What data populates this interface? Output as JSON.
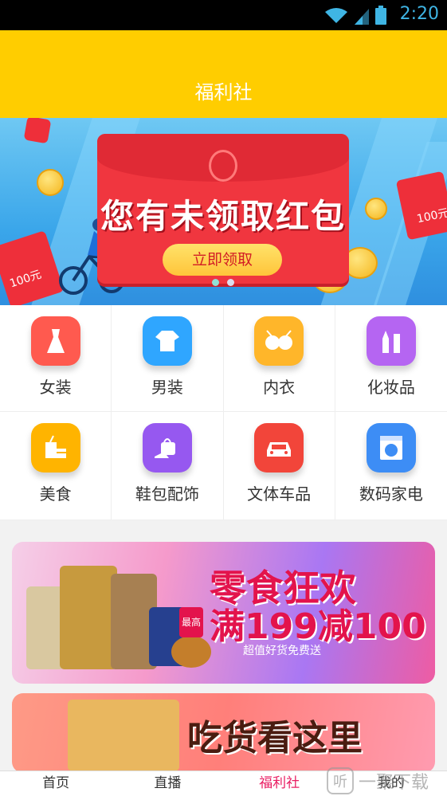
{
  "status_bar": {
    "time": "2:20"
  },
  "header": {
    "title": "福利社"
  },
  "banner": {
    "headline": "您有未领取红包",
    "button_label": "立即领取",
    "left_envelope_text": "100元",
    "right_envelope_text": "100元"
  },
  "categories": [
    {
      "label": "女装",
      "icon": "dress-icon",
      "color": "#ff5a4f"
    },
    {
      "label": "男装",
      "icon": "shirt-icon",
      "color": "#2fa6ff"
    },
    {
      "label": "内衣",
      "icon": "bra-icon",
      "color": "#ffb62a"
    },
    {
      "label": "化妆品",
      "icon": "cosmetics-icon",
      "color": "#b565f2"
    },
    {
      "label": "美食",
      "icon": "food-icon",
      "color": "#ffb400"
    },
    {
      "label": "鞋包配饰",
      "icon": "shoe-bag-icon",
      "color": "#9658f0"
    },
    {
      "label": "文体车品",
      "icon": "car-icon",
      "color": "#f2453a"
    },
    {
      "label": "数码家电",
      "icon": "washer-icon",
      "color": "#3d8df5"
    }
  ],
  "promos": [
    {
      "heading": "零食狂欢",
      "badge": "最高",
      "deal": "满199减100",
      "sub": "超值好货免费送"
    },
    {
      "heading": "吃货看这里"
    }
  ],
  "tabbar": {
    "items": [
      {
        "label": "首页",
        "active": false
      },
      {
        "label": "直播",
        "active": false
      },
      {
        "label": "福利社",
        "active": true
      },
      {
        "label": "我的",
        "active": false
      }
    ]
  },
  "watermark": {
    "text": "一聚下载",
    "glyph": "听"
  },
  "colors": {
    "header": "#ffcd00",
    "active_tab": "#e91e63",
    "envelope": "#f0363f"
  }
}
